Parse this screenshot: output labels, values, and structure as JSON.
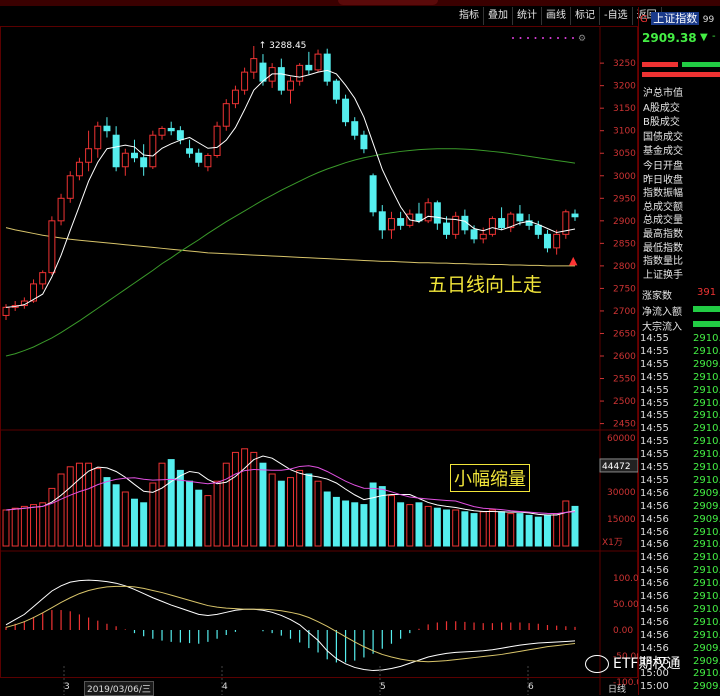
{
  "toolbar": {
    "items": [
      "指标",
      "叠加",
      "统计",
      "画线",
      "标记",
      "-自选",
      "返回"
    ]
  },
  "right_header": {
    "index_name": "上证指数",
    "code_prefix": "G",
    "code_suffix": "99",
    "price": "2909.38",
    "arrow": "▼",
    "change": "-"
  },
  "right_labels": {
    "group1": [
      "沪总市值",
      "A股成交",
      "B股成交",
      "国债成交",
      "基金成交"
    ],
    "group2": [
      "今日开盘",
      "昨日收盘",
      "指数振幅",
      "总成交额",
      "总成交量",
      "最高指数",
      "最低指数",
      "指数量比",
      "上证换手"
    ],
    "rise_count_label": "涨家数",
    "rise_count_value": "391",
    "net_inflow": "净流入额",
    "block_inflow": "大宗流入"
  },
  "ticks": {
    "times": [
      "14:55",
      "14:55",
      "14:55",
      "14:55",
      "14:55",
      "14:55",
      "14:55",
      "14:55",
      "14:55",
      "14:55",
      "14:55",
      "14:55",
      "14:56",
      "14:56",
      "14:56",
      "14:56",
      "14:56",
      "14:56",
      "14:56",
      "14:56",
      "14:56",
      "14:56",
      "14:56",
      "14:56",
      "14:56",
      "14:56",
      "15:00",
      "15:00"
    ],
    "values": [
      "2910.",
      "2910.",
      "2909.",
      "2910.",
      "2910.",
      "2910.",
      "2910.",
      "2910.",
      "2910.",
      "2910.",
      "2910.",
      "2910.",
      "2909.",
      "2909.",
      "2909.",
      "2910.",
      "2910.",
      "2910.",
      "2910.",
      "2910.",
      "2910.",
      "2910.",
      "2910.",
      "2910.",
      "2909.",
      "2909.",
      "2910.",
      "2909."
    ]
  },
  "price_axis": [
    "3250",
    "3200",
    "3150",
    "3100",
    "3050",
    "3000",
    "2950",
    "2900",
    "2850",
    "2800",
    "2750",
    "2700",
    "2650",
    "2600",
    "2550",
    "2500",
    "2450"
  ],
  "volume_axis": [
    "60000",
    "45000",
    "30000",
    "15000"
  ],
  "volume_cursor": "44472",
  "volume_unit": "X1万",
  "macd_axis": [
    "100.0",
    "50.00",
    "0.00",
    "-50.00",
    "-100.0"
  ],
  "x_axis": {
    "labels": [
      "3",
      "4",
      "5",
      "6"
    ],
    "cursor_date": "2019/03/06/三",
    "period": "日线"
  },
  "annotations": {
    "peak_label": "3288.45",
    "ma5_note": "五日线向上走",
    "volume_note": "小幅缩量"
  },
  "watermark": "ETF期权通",
  "colors": {
    "up": "#ee3333",
    "down": "#55eeee",
    "ma5": "#ffffff",
    "ma_long": "#3a9a2a",
    "ma_flat": "#d8c46a",
    "note": "#f2e63a",
    "axis_text": "#cc3333",
    "ticks_green": "#44ee44"
  },
  "chart_data": {
    "type": "candlestick",
    "candles": [
      {
        "o": 2690,
        "h": 2715,
        "l": 2680,
        "c": 2708
      },
      {
        "o": 2708,
        "h": 2722,
        "l": 2700,
        "c": 2712
      },
      {
        "o": 2712,
        "h": 2730,
        "l": 2705,
        "c": 2722
      },
      {
        "o": 2722,
        "h": 2770,
        "l": 2718,
        "c": 2760
      },
      {
        "o": 2760,
        "h": 2790,
        "l": 2748,
        "c": 2785
      },
      {
        "o": 2785,
        "h": 2910,
        "l": 2780,
        "c": 2900
      },
      {
        "o": 2900,
        "h": 2960,
        "l": 2890,
        "c": 2950
      },
      {
        "o": 2950,
        "h": 3010,
        "l": 2940,
        "c": 3000
      },
      {
        "o": 3000,
        "h": 3040,
        "l": 2990,
        "c": 3030
      },
      {
        "o": 3030,
        "h": 3100,
        "l": 3010,
        "c": 3060
      },
      {
        "o": 3060,
        "h": 3120,
        "l": 3040,
        "c": 3110
      },
      {
        "o": 3110,
        "h": 3130,
        "l": 3085,
        "c": 3100
      },
      {
        "o": 3090,
        "h": 3110,
        "l": 3010,
        "c": 3020
      },
      {
        "o": 3020,
        "h": 3060,
        "l": 3000,
        "c": 3050
      },
      {
        "o": 3050,
        "h": 3080,
        "l": 3030,
        "c": 3040
      },
      {
        "o": 3040,
        "h": 3070,
        "l": 3000,
        "c": 3020
      },
      {
        "o": 3020,
        "h": 3100,
        "l": 3015,
        "c": 3090
      },
      {
        "o": 3090,
        "h": 3110,
        "l": 3080,
        "c": 3105
      },
      {
        "o": 3105,
        "h": 3120,
        "l": 3090,
        "c": 3100
      },
      {
        "o": 3100,
        "h": 3110,
        "l": 3070,
        "c": 3080
      },
      {
        "o": 3060,
        "h": 3080,
        "l": 3040,
        "c": 3050
      },
      {
        "o": 3050,
        "h": 3060,
        "l": 3020,
        "c": 3030
      },
      {
        "o": 3020,
        "h": 3050,
        "l": 3010,
        "c": 3045
      },
      {
        "o": 3045,
        "h": 3120,
        "l": 3040,
        "c": 3110
      },
      {
        "o": 3110,
        "h": 3170,
        "l": 3100,
        "c": 3160
      },
      {
        "o": 3160,
        "h": 3200,
        "l": 3150,
        "c": 3190
      },
      {
        "o": 3190,
        "h": 3240,
        "l": 3180,
        "c": 3230
      },
      {
        "o": 3230,
        "h": 3288,
        "l": 3215,
        "c": 3260
      },
      {
        "o": 3250,
        "h": 3270,
        "l": 3200,
        "c": 3210
      },
      {
        "o": 3210,
        "h": 3250,
        "l": 3195,
        "c": 3240
      },
      {
        "o": 3240,
        "h": 3260,
        "l": 3180,
        "c": 3190
      },
      {
        "o": 3190,
        "h": 3220,
        "l": 3160,
        "c": 3210
      },
      {
        "o": 3210,
        "h": 3250,
        "l": 3200,
        "c": 3245
      },
      {
        "o": 3245,
        "h": 3275,
        "l": 3225,
        "c": 3235
      },
      {
        "o": 3235,
        "h": 3280,
        "l": 3230,
        "c": 3270
      },
      {
        "o": 3270,
        "h": 3282,
        "l": 3200,
        "c": 3210
      },
      {
        "o": 3210,
        "h": 3215,
        "l": 3160,
        "c": 3170
      },
      {
        "o": 3170,
        "h": 3180,
        "l": 3110,
        "c": 3120
      },
      {
        "o": 3120,
        "h": 3130,
        "l": 3080,
        "c": 3090
      },
      {
        "o": 3090,
        "h": 3100,
        "l": 3050,
        "c": 3060
      },
      {
        "o": 3000,
        "h": 3005,
        "l": 2910,
        "c": 2920
      },
      {
        "o": 2920,
        "h": 2935,
        "l": 2860,
        "c": 2880
      },
      {
        "o": 2880,
        "h": 2920,
        "l": 2860,
        "c": 2905
      },
      {
        "o": 2905,
        "h": 2920,
        "l": 2880,
        "c": 2890
      },
      {
        "o": 2890,
        "h": 2925,
        "l": 2885,
        "c": 2915
      },
      {
        "o": 2915,
        "h": 2940,
        "l": 2895,
        "c": 2900
      },
      {
        "o": 2900,
        "h": 2950,
        "l": 2895,
        "c": 2940
      },
      {
        "o": 2940,
        "h": 2945,
        "l": 2880,
        "c": 2895
      },
      {
        "o": 2895,
        "h": 2910,
        "l": 2860,
        "c": 2870
      },
      {
        "o": 2870,
        "h": 2920,
        "l": 2860,
        "c": 2910
      },
      {
        "o": 2910,
        "h": 2925,
        "l": 2870,
        "c": 2880
      },
      {
        "o": 2880,
        "h": 2890,
        "l": 2850,
        "c": 2860
      },
      {
        "o": 2860,
        "h": 2885,
        "l": 2850,
        "c": 2870
      },
      {
        "o": 2870,
        "h": 2910,
        "l": 2865,
        "c": 2905
      },
      {
        "o": 2905,
        "h": 2930,
        "l": 2880,
        "c": 2885
      },
      {
        "o": 2885,
        "h": 2920,
        "l": 2875,
        "c": 2915
      },
      {
        "o": 2915,
        "h": 2935,
        "l": 2890,
        "c": 2900
      },
      {
        "o": 2900,
        "h": 2915,
        "l": 2880,
        "c": 2890
      },
      {
        "o": 2890,
        "h": 2900,
        "l": 2860,
        "c": 2870
      },
      {
        "o": 2870,
        "h": 2880,
        "l": 2830,
        "c": 2840
      },
      {
        "o": 2840,
        "h": 2880,
        "l": 2825,
        "c": 2870
      },
      {
        "o": 2870,
        "h": 2925,
        "l": 2860,
        "c": 2920
      },
      {
        "o": 2915,
        "h": 2925,
        "l": 2900,
        "c": 2909
      }
    ],
    "ma_long_points": [
      2600,
      2605,
      2612,
      2620,
      2630,
      2640,
      2652,
      2665,
      2678,
      2692,
      2706,
      2720,
      2734,
      2748,
      2762,
      2776,
      2790,
      2805,
      2818,
      2832,
      2845,
      2858,
      2872,
      2885,
      2898,
      2910,
      2922,
      2934,
      2946,
      2957,
      2968,
      2978,
      2988,
      2998,
      3007,
      3015,
      3022,
      3029,
      3035,
      3040,
      3044,
      3048,
      3051,
      3054,
      3056,
      3058,
      3059,
      3060,
      3060,
      3060,
      3059,
      3058,
      3056,
      3054,
      3052,
      3049,
      3046,
      3043,
      3040,
      3037,
      3034,
      3031,
      3028
    ],
    "ma_flat_points": [
      2885,
      2880,
      2876,
      2872,
      2868,
      2865,
      2862,
      2859,
      2857,
      2855,
      2853,
      2851,
      2849,
      2847,
      2845,
      2843,
      2841,
      2839,
      2837,
      2835,
      2833,
      2831,
      2829,
      2828,
      2827,
      2826,
      2825,
      2824,
      2823,
      2822,
      2821,
      2820,
      2819,
      2818,
      2817,
      2816,
      2815,
      2814,
      2813,
      2812,
      2811,
      2810,
      2810,
      2809,
      2808,
      2807,
      2807,
      2806,
      2806,
      2805,
      2805,
      2804,
      2804,
      2803,
      2803,
      2802,
      2802,
      2801,
      2801,
      2800,
      2800,
      2800,
      2800
    ],
    "volumes": [
      20000,
      21000,
      22000,
      23000,
      24000,
      32000,
      40000,
      44000,
      46000,
      46000,
      43000,
      38000,
      34000,
      30000,
      26000,
      24000,
      35000,
      46000,
      48000,
      42000,
      36000,
      31000,
      28000,
      36000,
      46000,
      52000,
      54000,
      52000,
      46000,
      40000,
      36000,
      38000,
      42000,
      40000,
      36000,
      30000,
      27000,
      25000,
      24000,
      23000,
      35000,
      33000,
      28000,
      24000,
      23000,
      24000,
      22000,
      21000,
      20000,
      20000,
      19000,
      18000,
      19000,
      20000,
      19000,
      18000,
      18000,
      17000,
      16000,
      17000,
      18000,
      25000,
      22000
    ],
    "price_range": [
      2600,
      3288
    ],
    "volume_range": [
      0,
      60000
    ],
    "macd_range": [
      -100,
      100
    ],
    "dif": [
      10,
      20,
      30,
      45,
      60,
      75,
      85,
      92,
      95,
      96,
      95,
      93,
      90,
      85,
      78,
      70,
      62,
      55,
      48,
      42,
      36,
      30,
      28,
      30,
      34,
      38,
      40,
      40,
      38,
      34,
      28,
      20,
      10,
      -5,
      -20,
      -40,
      -55,
      -65,
      -72,
      -76,
      -78,
      -77,
      -74,
      -70,
      -64,
      -58,
      -52,
      -48,
      -45,
      -43,
      -42,
      -41,
      -40,
      -38,
      -35,
      -32,
      -29,
      -27,
      -25,
      -24,
      -23,
      -22,
      -21
    ],
    "dea": [
      5,
      10,
      16,
      24,
      33,
      43,
      53,
      62,
      70,
      76,
      80,
      83,
      84,
      84,
      83,
      80,
      76,
      72,
      67,
      62,
      57,
      52,
      47,
      44,
      42,
      41,
      40,
      40,
      40,
      39,
      37,
      34,
      30,
      24,
      16,
      7,
      -3,
      -13,
      -23,
      -32,
      -40,
      -47,
      -52,
      -56,
      -59,
      -60,
      -61,
      -60,
      -59,
      -57,
      -55,
      -53,
      -51,
      -49,
      -47,
      -44,
      -41,
      -38,
      -35,
      -32,
      -30,
      -28,
      -26
    ]
  }
}
